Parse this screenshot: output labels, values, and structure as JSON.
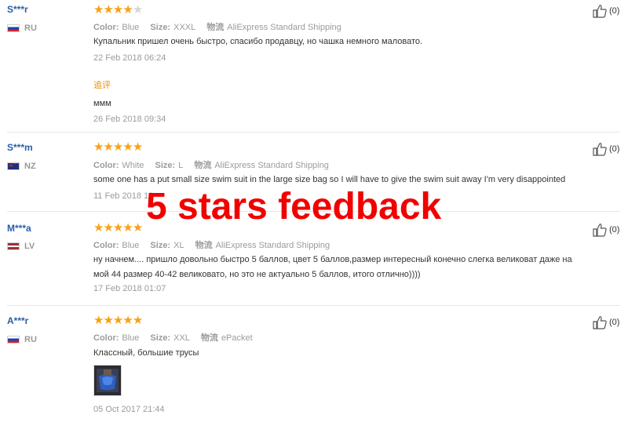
{
  "reviews": [
    {
      "user": "S***r",
      "country": "RU",
      "stars": 4,
      "max_stars": 5,
      "color_label": "Color:",
      "color": "Blue",
      "size_label": "Size:",
      "size": "XXXL",
      "shipping_label": "物流",
      "shipping": "AliExpress Standard Shipping",
      "text": "Купальник пришел очень быстро, спасибо продавцу, но чашка немного маловато.",
      "date": "22 Feb 2018 06:24",
      "additional_label": "追评",
      "additional_text": "ммм",
      "additional_date": "26 Feb 2018 09:34",
      "helpful": "(0)"
    },
    {
      "user": "S***m",
      "country": "NZ",
      "stars": 5,
      "max_stars": 5,
      "color_label": "Color:",
      "color": "White",
      "size_label": "Size:",
      "size": "L",
      "shipping_label": "物流",
      "shipping": "AliExpress Standard Shipping",
      "text": "some one has a put small size swim suit in the large size bag so I will have to give the swim suit away I'm very disappointed",
      "date": "11 Feb 2018 18",
      "helpful": "(0)"
    },
    {
      "user": "M***a",
      "country": "LV",
      "stars": 5,
      "max_stars": 5,
      "color_label": "Color:",
      "color": "Blue",
      "size_label": "Size:",
      "size": "XL",
      "shipping_label": "物流",
      "shipping": "AliExpress Standard Shipping",
      "text_line1": "ну начнем.... пришло довольно быстро 5 баллов, цвет 5 баллов,размер интересный конечно слегка великоват даже на",
      "text_line2": "мой 44 размер 40-42 великовато, но это не актуально 5 баллов, итого отлично))))",
      "date": "17 Feb 2018 01:07",
      "helpful": "(0)"
    },
    {
      "user": "A***r",
      "country": "RU",
      "stars": 5,
      "max_stars": 5,
      "color_label": "Color:",
      "color": "Blue",
      "size_label": "Size:",
      "size": "XXL",
      "shipping_label": "物流",
      "shipping": "ePacket",
      "text": "Классный, большие трусы",
      "date": "05 Oct 2017 21:44",
      "helpful": "(0)"
    }
  ],
  "overlay_text": "5 stars feedback",
  "colors": {
    "star": "#f7a11a",
    "username": "#2a5da8",
    "overlay": "#f20000",
    "additional": "#f08c00"
  }
}
